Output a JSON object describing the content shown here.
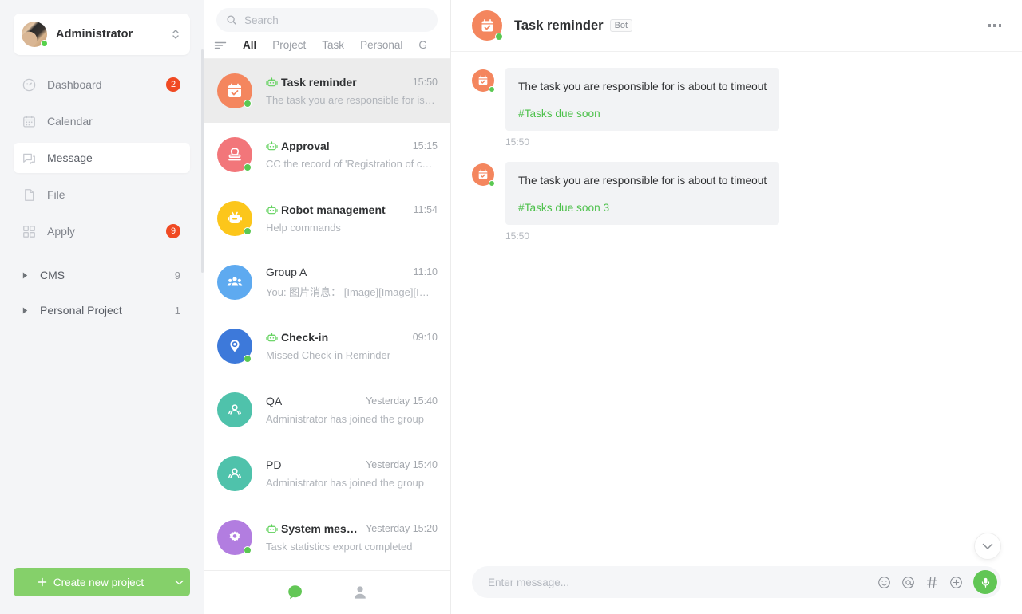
{
  "sidebar": {
    "user": {
      "name": "Administrator",
      "status": "online",
      "avatar": "user-photo-avatar",
      "switch_icon": "up-down-chevron-icon"
    },
    "items": [
      {
        "label": "Dashboard",
        "icon": "dashboard-icon",
        "badge": "2",
        "active": false
      },
      {
        "label": "Calendar",
        "icon": "calendar-icon",
        "badge": "",
        "active": false
      },
      {
        "label": "Message",
        "icon": "message-icon",
        "badge": "",
        "active": true
      },
      {
        "label": "File",
        "icon": "file-icon",
        "badge": "",
        "active": false
      },
      {
        "label": "Apply",
        "icon": "apply-grid-icon",
        "badge": "9",
        "active": false
      }
    ],
    "projects": [
      {
        "label": "CMS",
        "count": "9",
        "icon": "triangle-right-icon"
      },
      {
        "label": "Personal Project",
        "count": "1",
        "icon": "triangle-right-icon"
      }
    ],
    "create_button": {
      "label": "Create new project",
      "plus_icon": "plus-icon",
      "caret_icon": "chevron-down-icon",
      "color": "#85d06a"
    }
  },
  "list_panel": {
    "search": {
      "placeholder": "Search",
      "value": "",
      "icon": "search-icon"
    },
    "filter_icon": "filter-sort-icon",
    "tabs": [
      {
        "label": "All",
        "active": true
      },
      {
        "label": "Project",
        "active": false
      },
      {
        "label": "Task",
        "active": false
      },
      {
        "label": "Personal",
        "active": false
      },
      {
        "label": "G",
        "active": false
      }
    ],
    "conversations": [
      {
        "name": "Task reminder",
        "time": "15:50",
        "preview": "The task you are responsible for is ab...",
        "avatar_icon": "calendar-check-icon",
        "avatar_color": "#f4865e",
        "bot": true,
        "online": true,
        "active": true
      },
      {
        "name": "Approval",
        "time": "15:15",
        "preview": "CC the record of 'Registration of colle...",
        "avatar_icon": "stamp-icon",
        "avatar_color": "#f2767a",
        "bot": true,
        "online": true,
        "active": false
      },
      {
        "name": "Robot management",
        "time": "11:54",
        "preview": "Help commands",
        "avatar_icon": "robot-icon",
        "avatar_color": "#fcc61b",
        "bot": true,
        "online": true,
        "active": false
      },
      {
        "name": "Group A",
        "time": "11:10",
        "preview": "You: 图片消息： [Image][Image][Imag...",
        "avatar_icon": "group-people-icon",
        "avatar_color": "#5eaaf0",
        "bot": false,
        "online": false,
        "active": false
      },
      {
        "name": "Check-in",
        "time": "09:10",
        "preview": "Missed Check-in Reminder",
        "avatar_icon": "location-pin-icon",
        "avatar_color": "#3d79da",
        "bot": true,
        "online": true,
        "active": false
      },
      {
        "name": "QA",
        "time": "Yesterday 15:40",
        "preview": "Administrator has joined the group",
        "avatar_icon": "team-icon",
        "avatar_color": "#4fc2ab",
        "bot": false,
        "online": false,
        "active": false
      },
      {
        "name": "PD",
        "time": "Yesterday 15:40",
        "preview": "Administrator has joined the group",
        "avatar_icon": "team-icon",
        "avatar_color": "#4fc2ab",
        "bot": false,
        "online": false,
        "active": false
      },
      {
        "name": "System message",
        "time": "Yesterday 15:20",
        "preview": "Task statistics export completed",
        "avatar_icon": "gear-icon",
        "avatar_color": "#b27de0",
        "bot": true,
        "online": true,
        "active": false
      }
    ],
    "footer": [
      {
        "icon": "chat-bubble-icon",
        "active": true
      },
      {
        "icon": "contacts-person-icon",
        "active": false
      }
    ]
  },
  "chat": {
    "header": {
      "title": "Task reminder",
      "tag": "Bot",
      "avatar_icon": "calendar-check-icon",
      "avatar_color": "#f4865e",
      "online": true,
      "more_icon": "more-horizontal-icon"
    },
    "messages": [
      {
        "text": "The task you are responsible for is about to timeout",
        "tag": "#Tasks due soon",
        "time": "15:50",
        "avatar_icon": "calendar-check-icon",
        "online": true
      },
      {
        "text": "The task you are responsible for is about to timeout",
        "tag": "#Tasks due soon 3",
        "time": "15:50",
        "avatar_icon": "calendar-check-icon",
        "online": true
      }
    ],
    "scroll_down_icon": "chevron-down-icon",
    "input": {
      "placeholder": "Enter message...",
      "value": "",
      "actions": [
        {
          "icon": "emoji-icon"
        },
        {
          "icon": "mention-at-icon"
        },
        {
          "icon": "hashtag-icon"
        },
        {
          "icon": "plus-circle-icon"
        }
      ],
      "send": {
        "icon": "microphone-icon",
        "color": "#61c655"
      }
    }
  },
  "colors": {
    "accent_green": "#61c655",
    "badge_red": "#f04a23",
    "tag_green": "#4ec14c",
    "sidebar_bg": "#f4f5f7",
    "bubble_bg": "#f2f3f5"
  }
}
